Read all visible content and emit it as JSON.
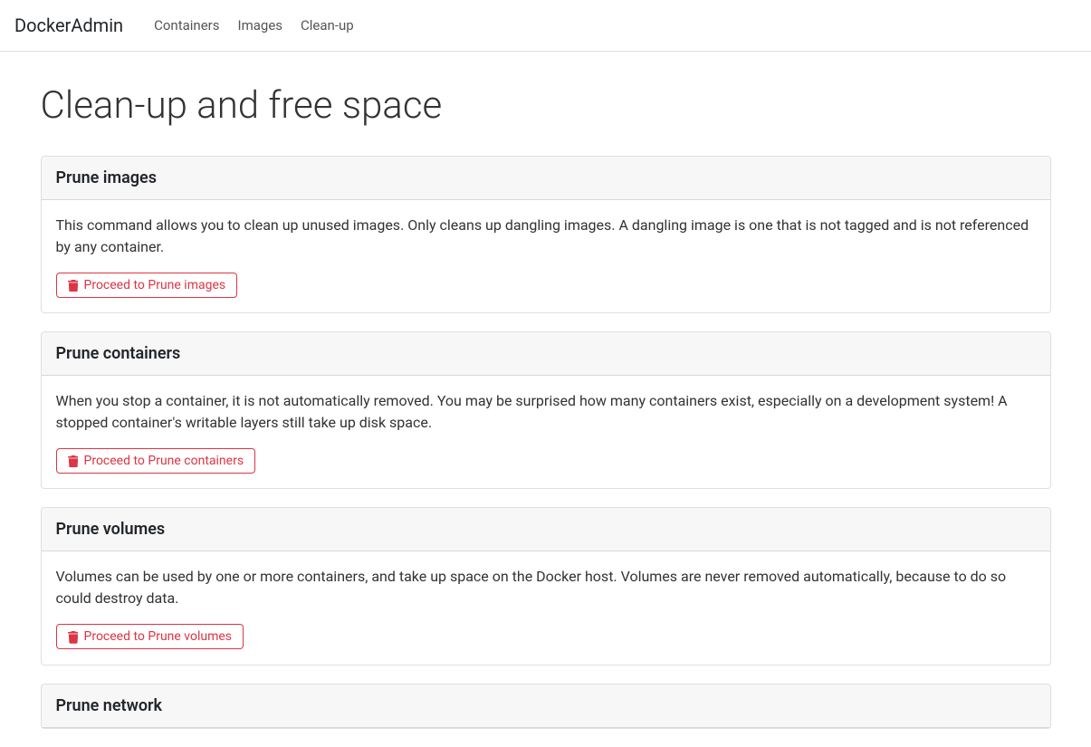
{
  "nav": {
    "brand": "DockerAdmin",
    "items": [
      "Containers",
      "Images",
      "Clean-up"
    ]
  },
  "page": {
    "title": "Clean-up and free space"
  },
  "cards": [
    {
      "header": "Prune images",
      "desc": "This command allows you to clean up unused images. Only cleans up dangling images. A dangling image is one that is not tagged and is not referenced by any container.",
      "button": "Proceed to Prune images"
    },
    {
      "header": "Prune containers",
      "desc": "When you stop a container, it is not automatically removed. You may be surprised how many containers exist, especially on a development system! A stopped container's writable layers still take up disk space.",
      "button": "Proceed to Prune containers"
    },
    {
      "header": "Prune volumes",
      "desc": "Volumes can be used by one or more containers, and take up space on the Docker host. Volumes are never removed automatically, because to do so could destroy data.",
      "button": "Proceed to Prune volumes"
    },
    {
      "header": "Prune network"
    }
  ]
}
